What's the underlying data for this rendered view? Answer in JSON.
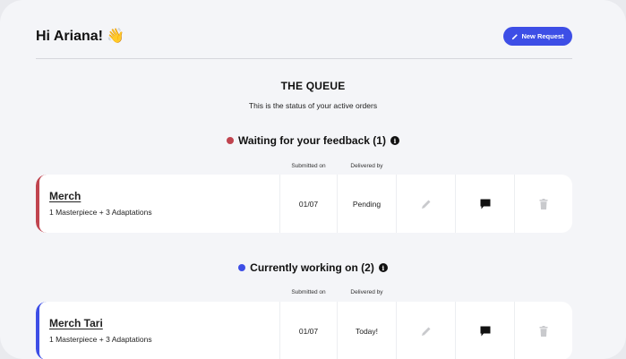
{
  "header": {
    "greeting": "Hi Ariana! 👋",
    "new_request_label": "New Request"
  },
  "queue": {
    "title": "THE QUEUE",
    "subtitle": "This is the status of your active orders"
  },
  "columns": {
    "submitted_on": "Submitted on",
    "delivered_by": "Delivered by"
  },
  "sections": [
    {
      "heading": "Waiting for your feedback (1)",
      "color": "#c0444f",
      "orders": [
        {
          "name": "Merch",
          "description": "1 Masterpiece + 3 Adaptations",
          "submitted_on": "01/07",
          "delivered_by": "Pending"
        }
      ]
    },
    {
      "heading": "Currently working on (2)",
      "color": "#3d4ee6",
      "orders": [
        {
          "name": "Merch Tari",
          "description": "1 Masterpiece + 3 Adaptations",
          "submitted_on": "01/07",
          "delivered_by": "Today!"
        }
      ]
    }
  ],
  "icons": {
    "edit": "pencil-icon",
    "comment": "comment-icon",
    "delete": "trash-icon",
    "info": "info-icon"
  },
  "colors": {
    "accent": "#3d4ee6",
    "feedback": "#c0444f",
    "working": "#3d4ee6"
  }
}
